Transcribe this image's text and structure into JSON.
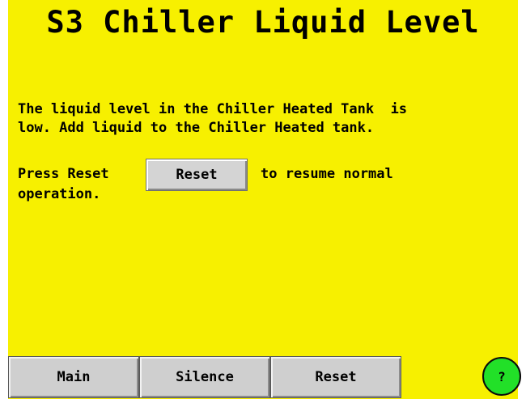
{
  "title": "S3 Chiller Liquid Level",
  "message": {
    "line1": "The liquid level in the Chiller Heated Tank  is",
    "line2": "low. Add liquid to the Chiller Heated tank."
  },
  "instruction": {
    "press_text": "Press Reset",
    "button_label": "Reset",
    "resume_text": "to resume normal",
    "continuation": "operation."
  },
  "bottom_nav": {
    "main": "Main",
    "silence": "Silence",
    "reset": "Reset"
  },
  "help": {
    "label": "?",
    "color": "#22e028"
  },
  "colors": {
    "background": "#f7f000",
    "button": "#cfcfcf"
  }
}
